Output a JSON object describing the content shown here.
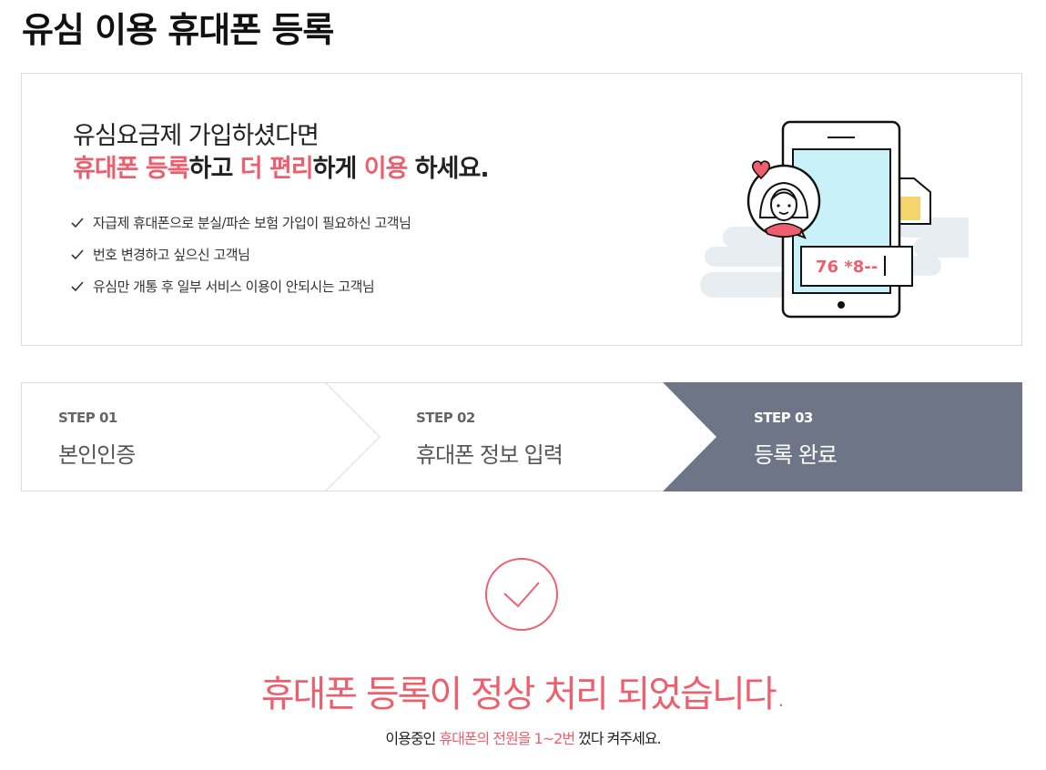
{
  "page": {
    "title": "유심 이용 휴대폰 등록"
  },
  "banner": {
    "line1": "유심요금제 가입하셨다면",
    "line2": {
      "seg1": "휴대폰 등록",
      "seg2": "하고 ",
      "seg3": "더 편리",
      "seg4": "하게 ",
      "seg5": "이용",
      "seg6": " 하세요."
    },
    "checklist": [
      "자급제 휴대폰으로 분실/파손 보험 가입이 필요하신 고객님",
      "번호 변경하고 싶으신 고객님",
      "유심만 개통 후 일부 서비스 이용이 안되시는 고객님"
    ],
    "illustration": {
      "number_text": "76 *8--"
    }
  },
  "steps": [
    {
      "label": "STEP 01",
      "name": "본인인증",
      "state": "done"
    },
    {
      "label": "STEP 02",
      "name": "휴대폰 정보 입력",
      "state": "done"
    },
    {
      "label": "STEP 03",
      "name": "등록 완료",
      "state": "active"
    }
  ],
  "result": {
    "title": "휴대폰 등록이 정상 처리 되었습니다.",
    "sub_pre": "이용중인 ",
    "sub_highlight": "휴대폰의 전원을 1~2번",
    "sub_post": " 껐다 켜주세요."
  },
  "colors": {
    "accent": "#ee5f6e",
    "step_active_bg": "#6e7587",
    "sky": "#c9f1f9",
    "sim": "#f6d46c",
    "cloud": "#e8edf2"
  }
}
